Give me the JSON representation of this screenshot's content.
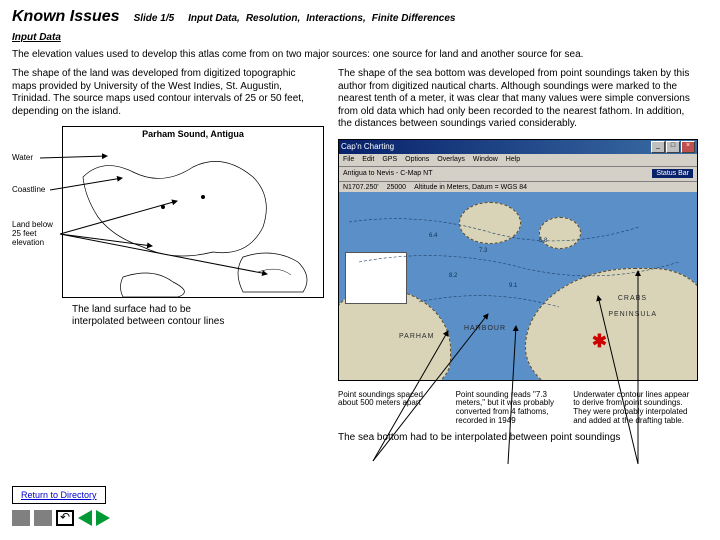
{
  "header": {
    "title": "Known Issues",
    "slide": "Slide 1/5",
    "topics": [
      "Input Data,",
      "Resolution,",
      "Interactions,",
      "Finite Differences"
    ]
  },
  "section": "Input Data",
  "intro": "The elevation values used to develop this atlas come from on two major sources: one source for land and another source for sea.",
  "left": {
    "para": "The shape of the land was developed from digitized topographic maps provided by University of the West Indies, St. Augustin, Trinidad.  The source maps used contour intervals of 25 or 50 feet, depending on the island.",
    "map_title": "Parham Sound, Antigua",
    "label_water": "Water",
    "label_coast": "Coastline",
    "label_land": "Land below 25 feet elevation",
    "interp": "The land surface had to be interpolated between contour lines"
  },
  "right": {
    "para": "The shape of the sea bottom was developed from point soundings taken by this author from digitized nautical charts. Although soundings were marked to the nearest tenth of a meter, it was clear that many values were simple conversions from old data which had only been recorded to the nearest fathom.  In addition, the distances between soundings varied considerably.",
    "window": {
      "title": "Cap'n Charting",
      "menu": [
        "File",
        "Edit",
        "GPS",
        "Options",
        "Overlays",
        "Window",
        "Help"
      ],
      "toolbar_chart": "Antigua to Nevis - C-Map NT",
      "status_label": "Status Bar",
      "coords": "N1707.250'",
      "scale": "25000",
      "datum": "Altitude in Meters,  Datum = WGS 84",
      "place_parham": "PARHAM",
      "place_harbour": "HARBOUR",
      "place_crabs": "CRABS",
      "place_peninsula": "PENINSULA"
    },
    "cap1": "Point soundings spaced about 500 meters apart",
    "cap2": "Point sounding reads \"7.3 meters,\" but it was probably converted from 4 fathoms, recorded in 1949",
    "cap3": "Underwater contour lines appear to derive from point soundings. They were probably interpolated and added at the drafting table.",
    "bottom": "The sea bottom had to be interpolated between point soundings"
  },
  "nav": {
    "return": "Return to Directory"
  }
}
